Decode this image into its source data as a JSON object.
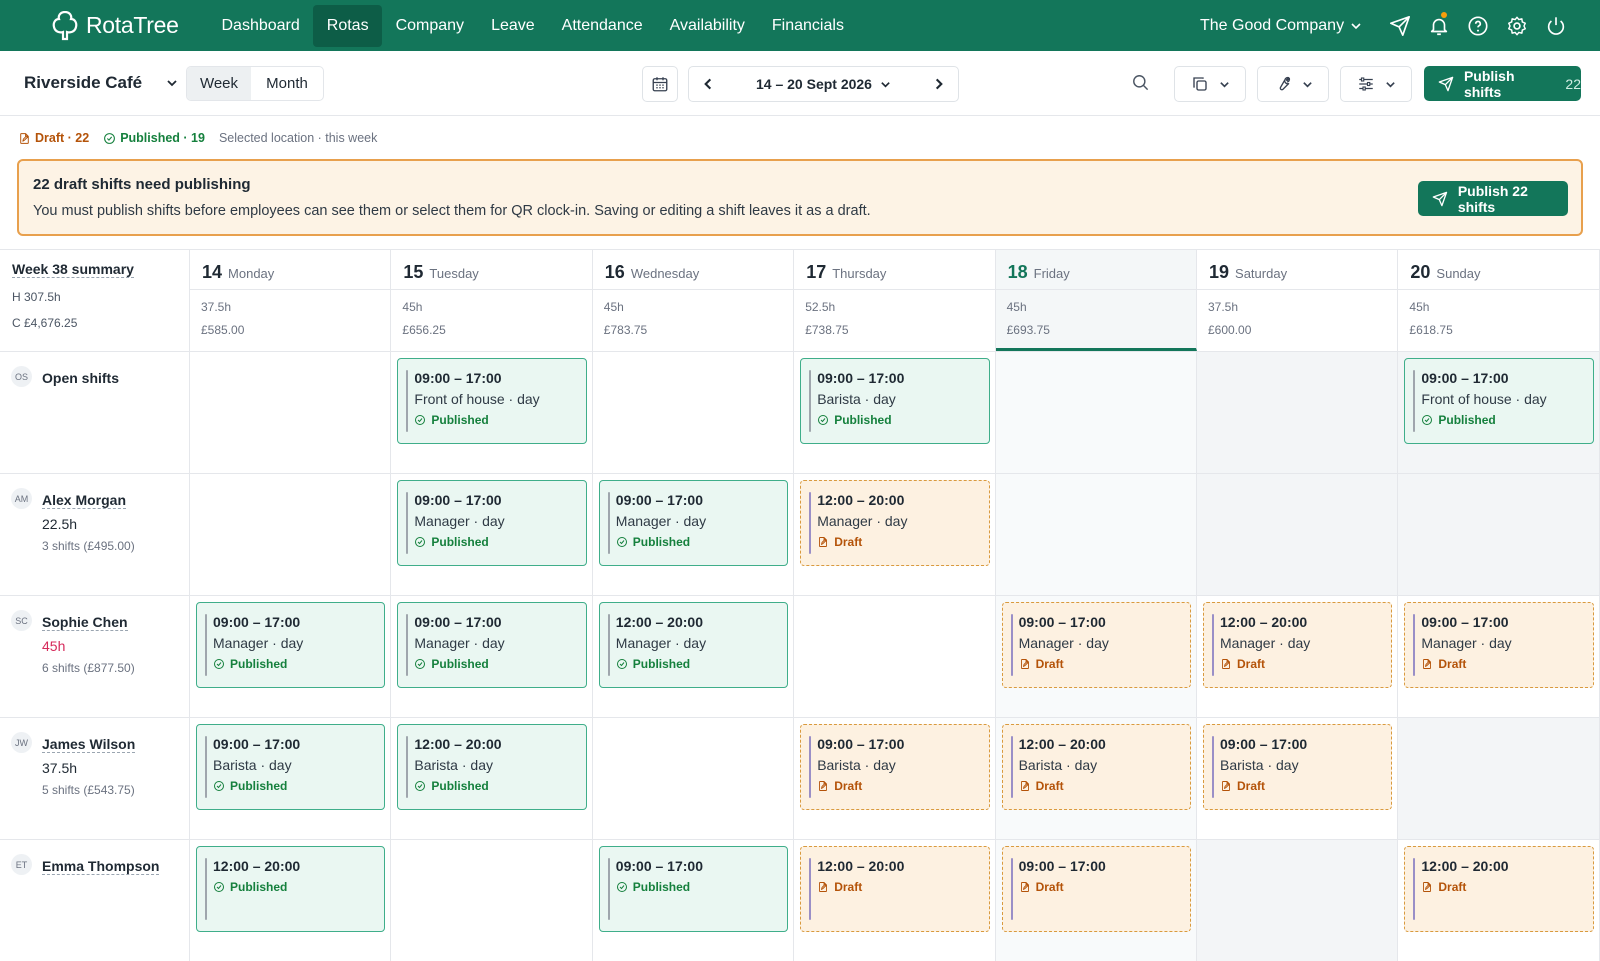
{
  "app": {
    "name": "RotaTree"
  },
  "nav": {
    "items": [
      {
        "label": "Dashboard"
      },
      {
        "label": "Rotas",
        "active": true
      },
      {
        "label": "Company"
      },
      {
        "label": "Leave"
      },
      {
        "label": "Attendance"
      },
      {
        "label": "Availability"
      },
      {
        "label": "Financials"
      }
    ]
  },
  "company": {
    "name": "The Good Company"
  },
  "toolbar": {
    "location": "Riverside Café",
    "view_week": "Week",
    "view_month": "Month",
    "date_range": "14 – 20 Sept 2026",
    "publish_label": "Publish shifts",
    "publish_count": "22"
  },
  "status": {
    "draft": "Draft · 22",
    "published": "Published · 19",
    "scope": "Selected location · this week"
  },
  "banner": {
    "title": "22 draft shifts need publishing",
    "body": "You must publish shifts before employees can see them or select them for QR clock-in. Saving or editing a shift leaves it as a draft.",
    "button": "Publish 22 shifts"
  },
  "summary": {
    "title": "Week 38 summary",
    "hours": "H  307.5h",
    "cost": "C  £4,676.25"
  },
  "days": [
    {
      "num": "14",
      "name": "Monday",
      "hours": "37.5h",
      "cost": "£585.00"
    },
    {
      "num": "15",
      "name": "Tuesday",
      "hours": "45h",
      "cost": "£656.25"
    },
    {
      "num": "16",
      "name": "Wednesday",
      "hours": "45h",
      "cost": "£783.75"
    },
    {
      "num": "17",
      "name": "Thursday",
      "hours": "52.5h",
      "cost": "£738.75"
    },
    {
      "num": "18",
      "name": "Friday",
      "hours": "45h",
      "cost": "£693.75",
      "today": true
    },
    {
      "num": "19",
      "name": "Saturday",
      "hours": "37.5h",
      "cost": "£600.00"
    },
    {
      "num": "20",
      "name": "Sunday",
      "hours": "45h",
      "cost": "£618.75"
    }
  ],
  "rows": [
    {
      "initials": "OS",
      "name": "Open shifts",
      "hours": "",
      "sub": "",
      "shifts": [
        null,
        {
          "time": "09:00 – 17:00",
          "role": "Front of house · day",
          "status": "Published"
        },
        null,
        {
          "time": "09:00 – 17:00",
          "role": "Barista · day",
          "status": "Published"
        },
        null,
        null,
        {
          "time": "09:00 – 17:00",
          "role": "Front of house · day",
          "status": "Published"
        }
      ]
    },
    {
      "initials": "AM",
      "name": "Alex Morgan",
      "hours": "22.5h",
      "sub": "3 shifts (£495.00)",
      "shifts": [
        null,
        {
          "time": "09:00 – 17:00",
          "role": "Manager · day",
          "status": "Published"
        },
        {
          "time": "09:00 – 17:00",
          "role": "Manager · day",
          "status": "Published"
        },
        {
          "time": "12:00 – 20:00",
          "role": "Manager · day",
          "status": "Draft"
        },
        null,
        null,
        null
      ]
    },
    {
      "initials": "SC",
      "name": "Sophie Chen",
      "hours": "45h",
      "hours_alert": true,
      "sub": "6 shifts (£877.50)",
      "shifts": [
        {
          "time": "09:00 – 17:00",
          "role": "Manager · day",
          "status": "Published"
        },
        {
          "time": "09:00 – 17:00",
          "role": "Manager · day",
          "status": "Published"
        },
        {
          "time": "12:00 – 20:00",
          "role": "Manager · day",
          "status": "Published"
        },
        null,
        {
          "time": "09:00 – 17:00",
          "role": "Manager · day",
          "status": "Draft"
        },
        {
          "time": "12:00 – 20:00",
          "role": "Manager · day",
          "status": "Draft"
        },
        {
          "time": "09:00 – 17:00",
          "role": "Manager · day",
          "status": "Draft"
        }
      ]
    },
    {
      "initials": "JW",
      "name": "James Wilson",
      "hours": "37.5h",
      "sub": "5 shifts (£543.75)",
      "shifts": [
        {
          "time": "09:00 – 17:00",
          "role": "Barista · day",
          "status": "Published"
        },
        {
          "time": "12:00 – 20:00",
          "role": "Barista · day",
          "status": "Published"
        },
        null,
        {
          "time": "09:00 – 17:00",
          "role": "Barista · day",
          "status": "Draft"
        },
        {
          "time": "12:00 – 20:00",
          "role": "Barista · day",
          "status": "Draft"
        },
        {
          "time": "09:00 – 17:00",
          "role": "Barista · day",
          "status": "Draft"
        },
        null
      ]
    },
    {
      "initials": "ET",
      "name": "Emma Thompson",
      "hours": "",
      "sub": "",
      "shifts": [
        {
          "time": "12:00 – 20:00",
          "role": "",
          "status": "Published"
        },
        null,
        {
          "time": "09:00 – 17:00",
          "role": "",
          "status": "Published"
        },
        {
          "time": "12:00 – 20:00",
          "role": "",
          "status": "Draft"
        },
        {
          "time": "09:00 – 17:00",
          "role": "",
          "status": "Draft"
        },
        null,
        {
          "time": "12:00 – 20:00",
          "role": "",
          "status": "Draft"
        }
      ]
    }
  ],
  "colors": {
    "brand": "#13765a",
    "draft": "#b45309",
    "published": "#15803d",
    "alert": "#d62a5b"
  }
}
